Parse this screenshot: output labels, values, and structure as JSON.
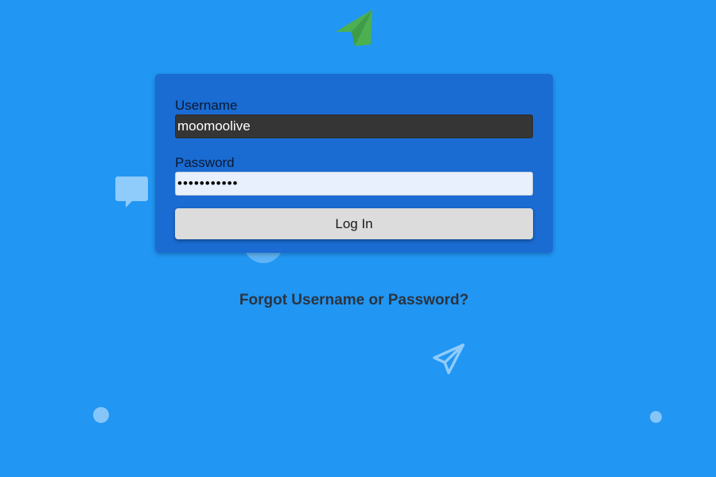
{
  "login_form": {
    "username_label": "Username",
    "username_value": "moomoolive",
    "password_label": "Password",
    "password_value": "•••••••••••",
    "login_button_label": "Log In"
  },
  "forgot_link_label": "Forgot Username or Password?",
  "icons": {
    "logo": "paper-plane-icon",
    "chat": "chat-bubble-icon",
    "outline_plane": "paper-plane-outline-icon"
  },
  "colors": {
    "background": "#2196f3",
    "card": "#1a6bd2",
    "logo": "#4caf50",
    "username_field": "#353535",
    "password_field": "#e8f0fe",
    "button": "#dcdcdc"
  }
}
